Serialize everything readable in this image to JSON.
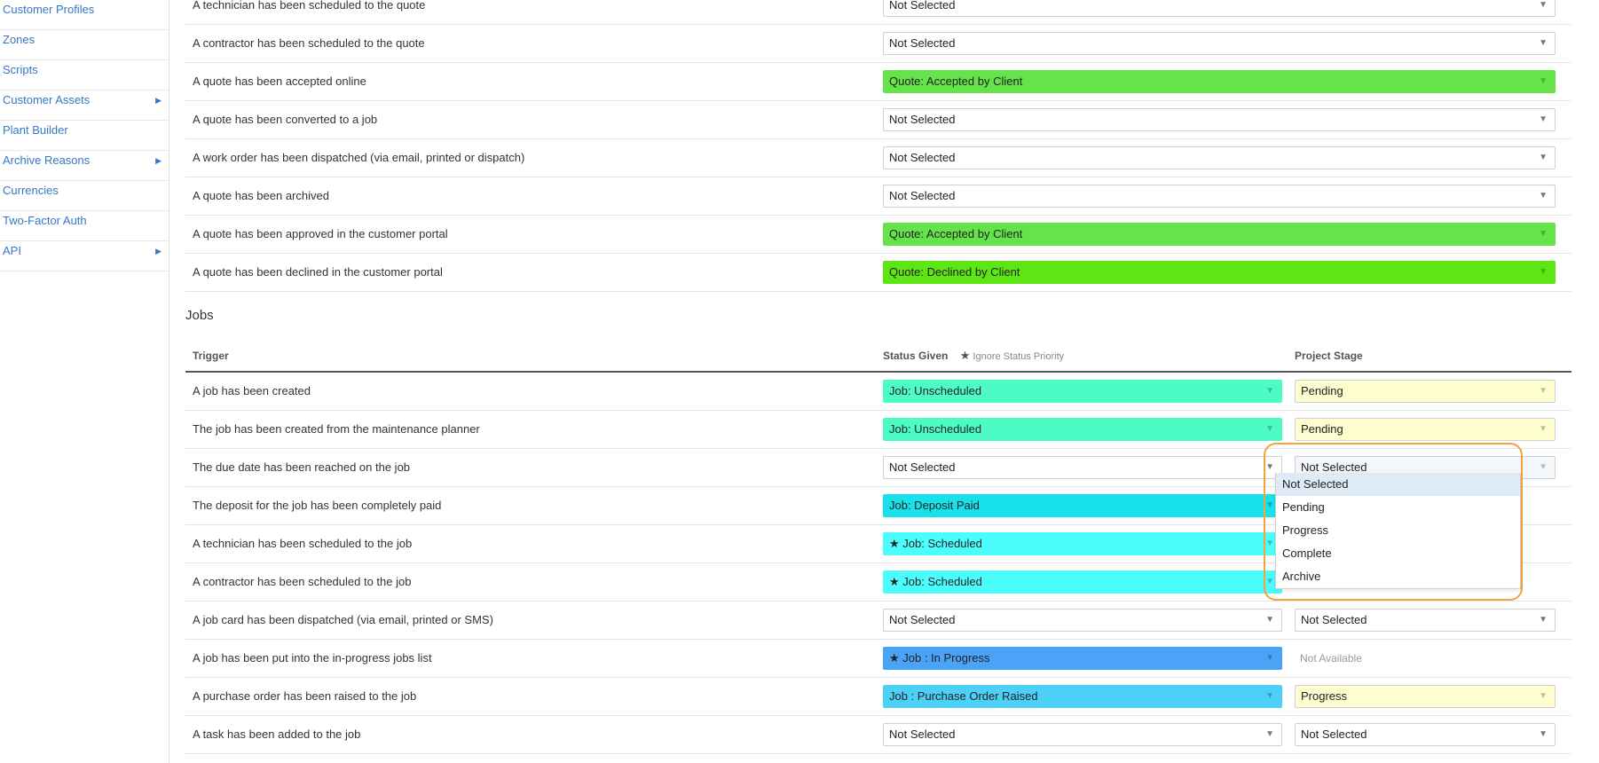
{
  "sidebar": {
    "items": [
      {
        "label": "Customer Profiles",
        "submenu": false
      },
      {
        "label": "Zones",
        "submenu": false
      },
      {
        "label": "Scripts",
        "submenu": false
      },
      {
        "label": "Customer Assets",
        "submenu": true
      },
      {
        "label": "Plant Builder",
        "submenu": false
      },
      {
        "label": "Archive Reasons",
        "submenu": true
      },
      {
        "label": "Currencies",
        "submenu": false
      },
      {
        "label": "Two-Factor Auth",
        "submenu": false
      },
      {
        "label": "API",
        "submenu": true
      }
    ],
    "submenu_arrow": "▶"
  },
  "quotes": {
    "rows": [
      {
        "trigger": "A technician has been scheduled to the quote",
        "status": "Not Selected",
        "status_color": ""
      },
      {
        "trigger": "A contractor has been scheduled to the quote",
        "status": "Not Selected",
        "status_color": ""
      },
      {
        "trigger": "A quote has been accepted online",
        "status": "Quote: Accepted by Client",
        "status_color": "#66e24a"
      },
      {
        "trigger": "A quote has been converted to a job",
        "status": "Not Selected",
        "status_color": ""
      },
      {
        "trigger": "A work order has been dispatched (via email, printed or dispatch)",
        "status": "Not Selected",
        "status_color": ""
      },
      {
        "trigger": "A quote has been archived",
        "status": "Not Selected",
        "status_color": ""
      },
      {
        "trigger": "A quote has been approved in the customer portal",
        "status": "Quote: Accepted by Client",
        "status_color": "#66e24a"
      },
      {
        "trigger": "A quote has been declined in the customer portal",
        "status": "Quote: Declined by Client",
        "status_color": "#5ee614"
      }
    ]
  },
  "jobs": {
    "title": "Jobs",
    "headers": {
      "trigger": "Trigger",
      "status_given": "Status Given",
      "star": "★",
      "ignore_priority": "Ignore Status Priority",
      "project_stage": "Project Stage"
    },
    "rows": [
      {
        "trigger": "A job has been created",
        "status": "Job: Unscheduled",
        "status_color": "#4dfcc4",
        "stage": "Pending",
        "stage_color": "#fdfdd0"
      },
      {
        "trigger": "The job has been created from the maintenance planner",
        "status": "Job: Unscheduled",
        "status_color": "#4dfcc4",
        "stage": "Pending",
        "stage_color": "#fdfdd0"
      },
      {
        "trigger": "The due date has been reached on the job",
        "status": "Not Selected",
        "status_color": "",
        "stage": "Not Selected",
        "stage_color": "#f3f6fa"
      },
      {
        "trigger": "The deposit for the job has been completely paid",
        "status": "Job: Deposit Paid",
        "status_color": "#17e2ec",
        "stage": "",
        "stage_color": ""
      },
      {
        "trigger": "A technician has been scheduled to the job",
        "status": "★ Job: Scheduled",
        "status_color": "#4cfdfd",
        "stage": "",
        "stage_color": ""
      },
      {
        "trigger": "A contractor has been scheduled to the job",
        "status": "★ Job: Scheduled",
        "status_color": "#4cfdfd",
        "stage": "",
        "stage_color": ""
      },
      {
        "trigger": "A job card has been dispatched (via email, printed or SMS)",
        "status": "Not Selected",
        "status_color": "",
        "stage": "Not Selected",
        "stage_color": ""
      },
      {
        "trigger": "A job has been put into the in-progress jobs list",
        "status": "★ Job : In Progress",
        "status_color": "#4aa3f7",
        "stage": "Not Available",
        "stage_color": "na"
      },
      {
        "trigger": "A purchase order has been raised to the job",
        "status": "Job : Purchase Order Raised",
        "status_color": "#4cd0f5",
        "stage": "Progress",
        "stage_color": "#fdfdd0"
      },
      {
        "trigger": "A task has been added to the job",
        "status": "Not Selected",
        "status_color": "",
        "stage": "Not Selected",
        "stage_color": ""
      }
    ]
  },
  "stage_dropdown": {
    "options": [
      "Not Selected",
      "Pending",
      "Progress",
      "Complete",
      "Archive"
    ],
    "selected_index": 0
  },
  "caret": "▼"
}
